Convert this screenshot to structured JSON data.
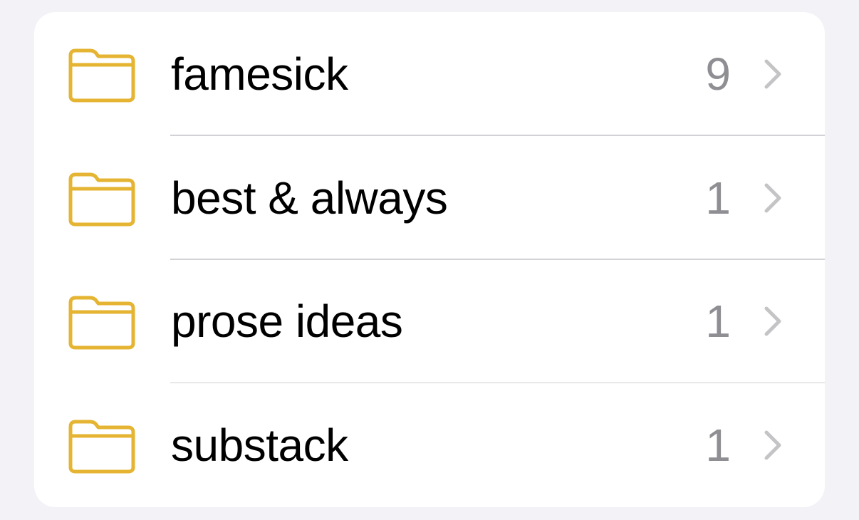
{
  "colors": {
    "folder_accent": "#E4B432",
    "count_text": "#8E8E93",
    "chevron": "#C4C4C7",
    "background": "#F2F2F7"
  },
  "folders": [
    {
      "name": "famesick",
      "count": "9",
      "icon": "folder-icon",
      "trailing_icon": "chevron-right-icon"
    },
    {
      "name": "best & always",
      "count": "1",
      "icon": "folder-icon",
      "trailing_icon": "chevron-right-icon"
    },
    {
      "name": "prose ideas",
      "count": "1",
      "icon": "folder-icon",
      "trailing_icon": "chevron-right-icon"
    },
    {
      "name": "substack",
      "count": "1",
      "icon": "folder-icon",
      "trailing_icon": "chevron-right-icon"
    }
  ]
}
